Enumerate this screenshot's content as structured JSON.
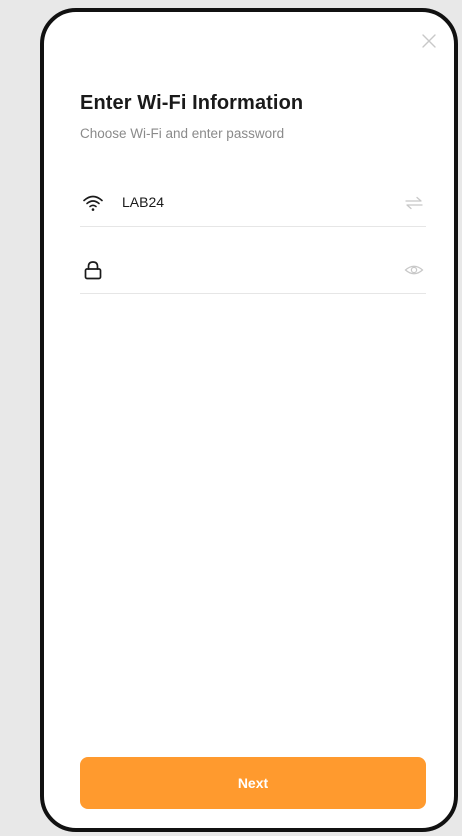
{
  "screen": {
    "title": "Enter Wi-Fi Information",
    "subtitle": "Choose Wi-Fi and enter password"
  },
  "wifi": {
    "ssid": "LAB24",
    "icon": "wifi-icon",
    "action_icon": "switch-network-icon"
  },
  "password": {
    "value": "",
    "placeholder": "",
    "icon": "lock-icon",
    "action_icon": "eye-icon"
  },
  "actions": {
    "next_label": "Next",
    "close_icon": "close-icon"
  },
  "colors": {
    "accent": "#ff9a2e",
    "title": "#1a1a1a",
    "subtitle": "#8a8a8a",
    "divider": "#e6e6e6",
    "icon_muted": "#c8c8c8",
    "background": "#ffffff",
    "frame": "#111111",
    "page_background": "#e8e8e8"
  }
}
